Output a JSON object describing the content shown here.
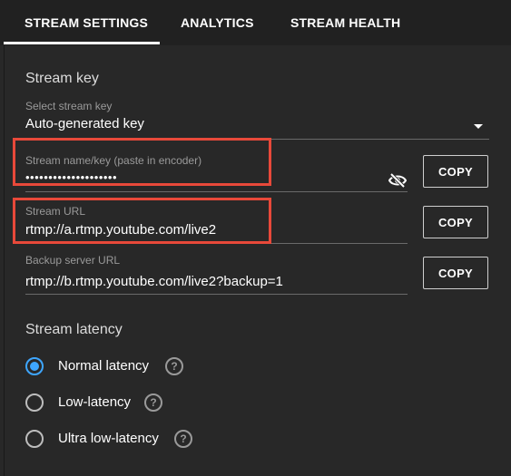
{
  "tabs": [
    {
      "label": "STREAM SETTINGS",
      "active": true
    },
    {
      "label": "ANALYTICS",
      "active": false
    },
    {
      "label": "STREAM HEALTH",
      "active": false
    }
  ],
  "stream_key_section": {
    "title": "Stream key",
    "select": {
      "label": "Select stream key",
      "value": "Auto-generated key"
    },
    "name_key": {
      "label": "Stream name/key (paste in encoder)",
      "value": "••••••••••••••••••••",
      "copy_label": "COPY"
    },
    "url": {
      "label": "Stream URL",
      "value": "rtmp://a.rtmp.youtube.com/live2",
      "copy_label": "COPY"
    },
    "backup_url": {
      "label": "Backup server URL",
      "value": "rtmp://b.rtmp.youtube.com/live2?backup=1",
      "copy_label": "COPY"
    }
  },
  "latency_section": {
    "title": "Stream latency",
    "options": [
      {
        "label": "Normal latency",
        "selected": true
      },
      {
        "label": "Low-latency",
        "selected": false
      },
      {
        "label": "Ultra low-latency",
        "selected": false
      }
    ],
    "help_glyph": "?"
  },
  "colors": {
    "accent": "#3ea6ff",
    "highlight": "#e8493a",
    "background": "#282828"
  }
}
